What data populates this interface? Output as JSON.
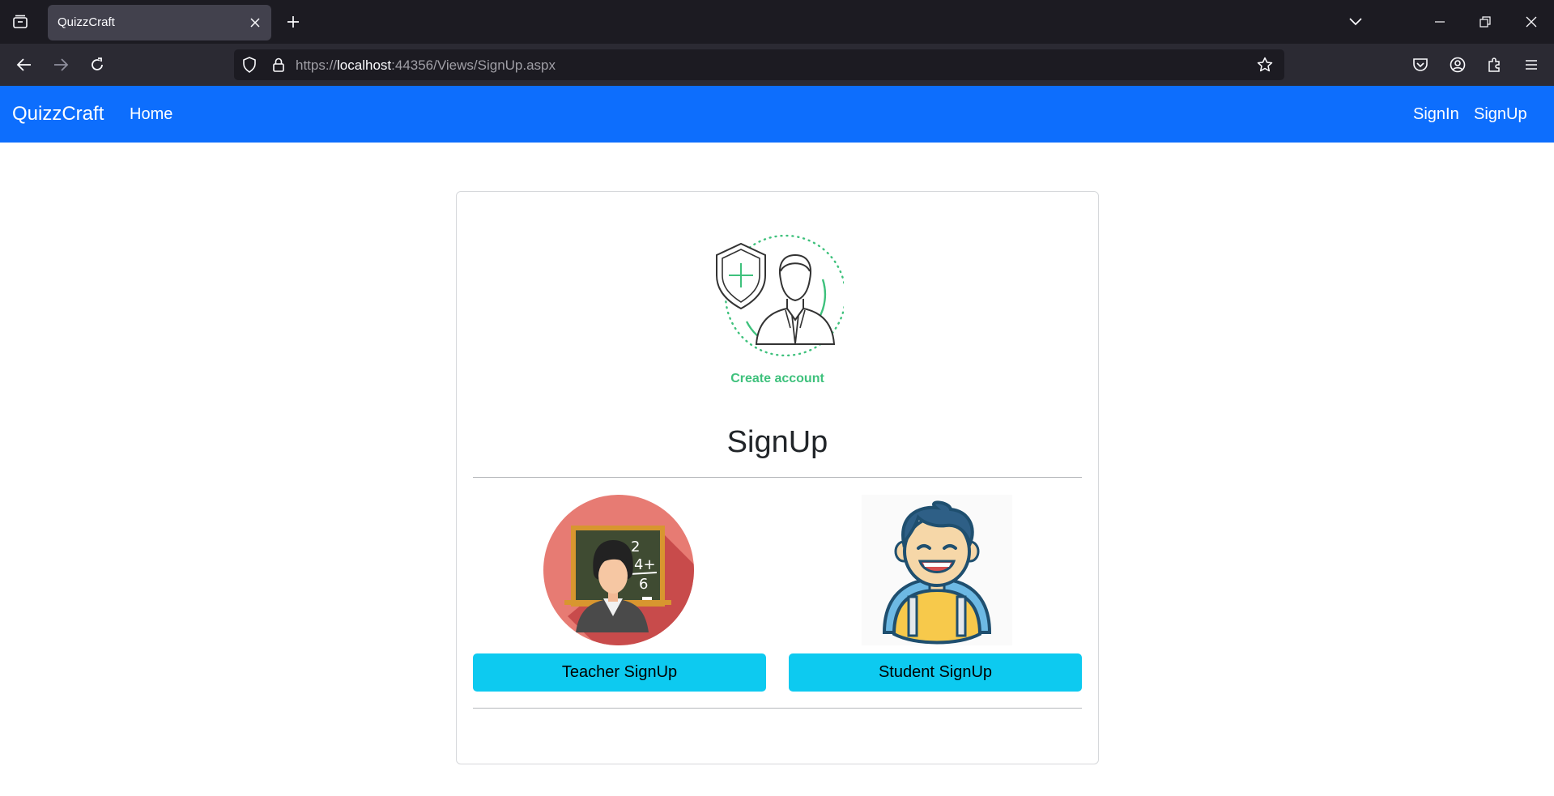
{
  "browser": {
    "tab_title": "QuizzCraft",
    "url_prefix": "https://",
    "url_host": "localhost",
    "url_rest": ":44356/Views/SignUp.aspx"
  },
  "site_nav": {
    "brand": "QuizzCraft",
    "home": "Home",
    "signin": "SignIn",
    "signup": "SignUp",
    "color": "#0d6efd"
  },
  "card": {
    "create_label": "Create account",
    "title": "SignUp",
    "teacher_button": "Teacher SignUp",
    "student_button": "Student SignUp",
    "button_color": "#0dcaf0",
    "accent_green": "#3ec17c"
  },
  "icons": [
    "tab-list-icon",
    "close-icon",
    "plus-icon",
    "chevron-down-icon",
    "minimize-icon",
    "restore-icon",
    "back-icon",
    "forward-icon",
    "reload-icon",
    "shield-icon",
    "lock-icon",
    "star-icon",
    "pocket-icon",
    "account-icon",
    "extensions-icon",
    "menu-icon"
  ]
}
